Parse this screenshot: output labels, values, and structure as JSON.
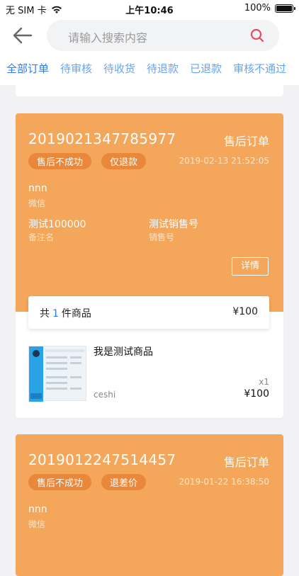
{
  "status_bar": {
    "carrier": "无 SIM 卡",
    "time": "上午10:46",
    "battery": "100%"
  },
  "search": {
    "placeholder": "请输入搜索内容"
  },
  "tabs": [
    {
      "label": "全部订单",
      "active": true
    },
    {
      "label": "待审核"
    },
    {
      "label": "待收货"
    },
    {
      "label": "待退款"
    },
    {
      "label": "已退款"
    },
    {
      "label": "审核不通过"
    }
  ],
  "orders": [
    {
      "order_no": "2019021347785977",
      "type": "售后订单",
      "badges": [
        "售后不成功",
        "仅退款"
      ],
      "date": "2019-02-13 21:52:05",
      "customer": "nnn",
      "channel": "微信",
      "remark_value": "测试100000",
      "remark_label": "备注名",
      "sales_value": "测试销售号",
      "sales_label": "销售号",
      "detail_button": "详情",
      "summary_prefix": "共",
      "summary_count": "1",
      "summary_suffix": "件商品",
      "summary_total": "¥100",
      "product": {
        "name": "我是测试商品",
        "sub": "ceshi",
        "qty": "x1",
        "price": "¥100"
      }
    },
    {
      "order_no": "2019012247514457",
      "type": "售后订单",
      "badges": [
        "售后不成功",
        "退差价"
      ],
      "date": "2019-01-22 16:38:50",
      "customer": "nnn",
      "channel": "微信"
    }
  ],
  "colors": {
    "accent": "#2f7be8",
    "card": "#f4a75a",
    "badge": "#e9873a"
  }
}
